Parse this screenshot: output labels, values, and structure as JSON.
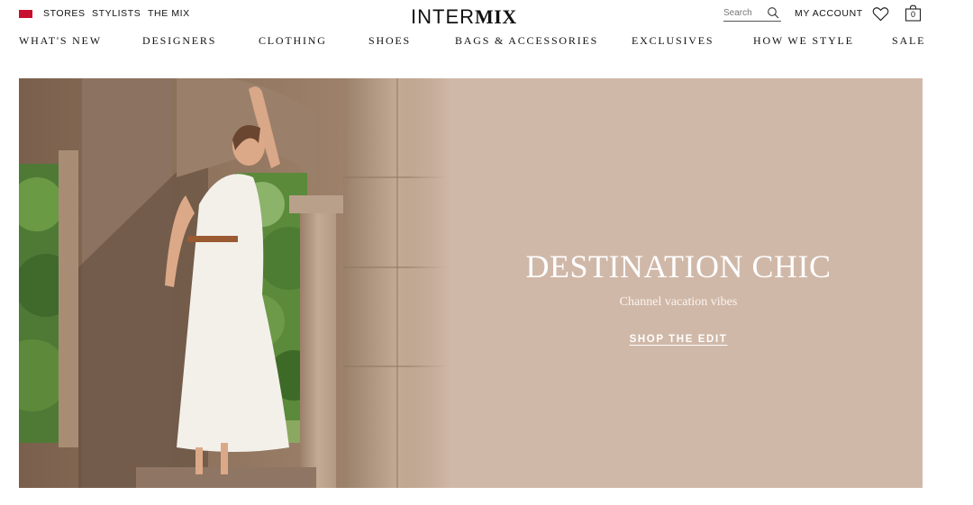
{
  "header": {
    "util_links": {
      "stores": "STORES",
      "stylists": "STYLISTS",
      "the_mix": "THE MIX"
    },
    "flag_color": "#c8102e",
    "logo": {
      "part1": "INTER",
      "part2": "MIX"
    },
    "search": {
      "placeholder": "Search",
      "icon": "search-icon"
    },
    "account_label": "MY ACCOUNT",
    "wishlist_icon": "heart-icon",
    "bag": {
      "icon": "shopping-bag-icon",
      "count": "0"
    }
  },
  "nav": {
    "items": [
      "WHAT'S NEW",
      "DESIGNERS",
      "CLOTHING",
      "SHOES",
      "BAGS & ACCESSORIES",
      "EXCLUSIVES",
      "HOW WE STYLE",
      "SALE"
    ]
  },
  "hero": {
    "title": "DESTINATION CHIC",
    "subtitle": "Channel vacation vibes",
    "cta": "SHOP THE EDIT",
    "background_color": "#d0b8a8"
  }
}
